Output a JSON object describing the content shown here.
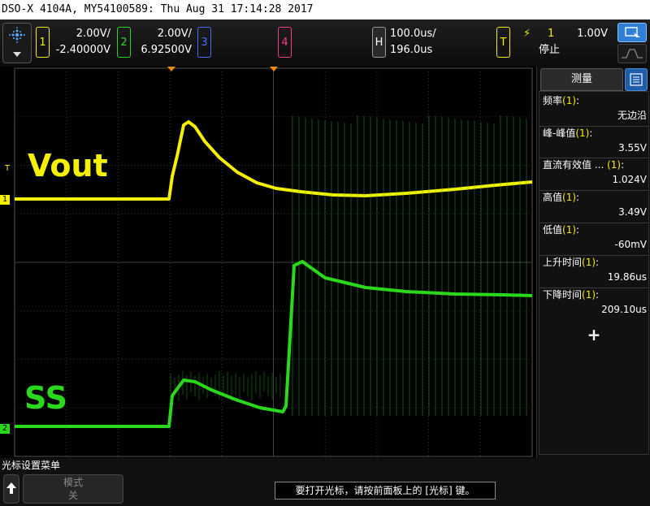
{
  "titlebar": {
    "text": "DSO-X 4104A, MY54100589: Thu Aug 31 17:14:28 2017"
  },
  "channels": [
    {
      "num": "1",
      "scale": "2.00V/",
      "offset": "-2.40000V",
      "color": "#f4f000"
    },
    {
      "num": "2",
      "scale": "2.00V/",
      "offset": "6.92500V",
      "color": "#2ad91c"
    },
    {
      "num": "3",
      "color": "#4a6cff"
    },
    {
      "num": "4",
      "color": "#ff3d8a"
    }
  ],
  "horizontal": {
    "key": "H",
    "timebase": "100.0us/",
    "delay": "196.0us"
  },
  "trigger": {
    "key": "T",
    "slope_glyph": "⚡",
    "source": "1",
    "level": "1.00V",
    "status": "停止"
  },
  "waveforms": {
    "ch1_label": "Vout",
    "ch2_label": "SS"
  },
  "panel": {
    "tab": "测量",
    "measurements": [
      {
        "label": "频率",
        "ch": "(1)",
        "value": "无边沿"
      },
      {
        "label": "峰-峰值",
        "ch": "(1)",
        "value": "3.55V"
      },
      {
        "label": "直流有效值 ...",
        "ch": "(1)",
        "value": "1.024V"
      },
      {
        "label": "高值",
        "ch": "(1)",
        "value": "3.49V"
      },
      {
        "label": "低值",
        "ch": "(1)",
        "value": "-60mV"
      },
      {
        "label": "上升时间",
        "ch": "(1)",
        "value": "19.86us"
      },
      {
        "label": "下降时间",
        "ch": "(1)",
        "value": "209.10us"
      }
    ],
    "add_glyph": "+"
  },
  "bottom": {
    "menu_title": "光标设置菜单",
    "mode_label": "模式",
    "mode_value": "关",
    "hint": "要打开光标，请按前面板上的 [光标] 键。"
  },
  "markers": {
    "ch1": "1",
    "ch2": "2",
    "trigger": "T"
  }
}
